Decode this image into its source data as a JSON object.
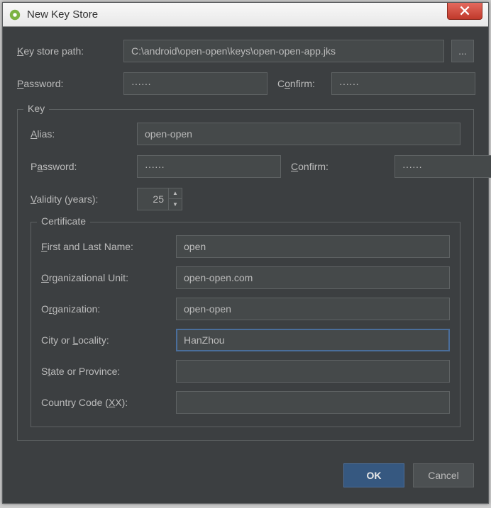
{
  "window": {
    "title": "New Key Store"
  },
  "keystore": {
    "path_label": "Key store path:",
    "path_value": "C:\\android\\open-open\\keys\\open-open-app.jks",
    "browse_label": "...",
    "password_label": "Password:",
    "password_value": "······",
    "confirm_label": "Confirm:",
    "confirm_value": "······"
  },
  "key_group": {
    "legend": "Key",
    "alias_label": "Alias:",
    "alias_value": "open-open",
    "password_label": "Password:",
    "password_value": "······",
    "confirm_label": "Confirm:",
    "confirm_value": "······",
    "validity_label": "Validity (years):",
    "validity_value": "25"
  },
  "certificate": {
    "legend": "Certificate",
    "first_last_label": "First and Last Name:",
    "first_last_value": "open",
    "org_unit_label": "Organizational Unit:",
    "org_unit_value": "open-open.com",
    "org_label": "Organization:",
    "org_value": "open-open",
    "city_label": "City or Locality:",
    "city_value": "HanZhou",
    "state_label": "State or Province:",
    "state_value": "",
    "country_label": "Country Code (XX):",
    "country_value": ""
  },
  "buttons": {
    "ok": "OK",
    "cancel": "Cancel"
  }
}
